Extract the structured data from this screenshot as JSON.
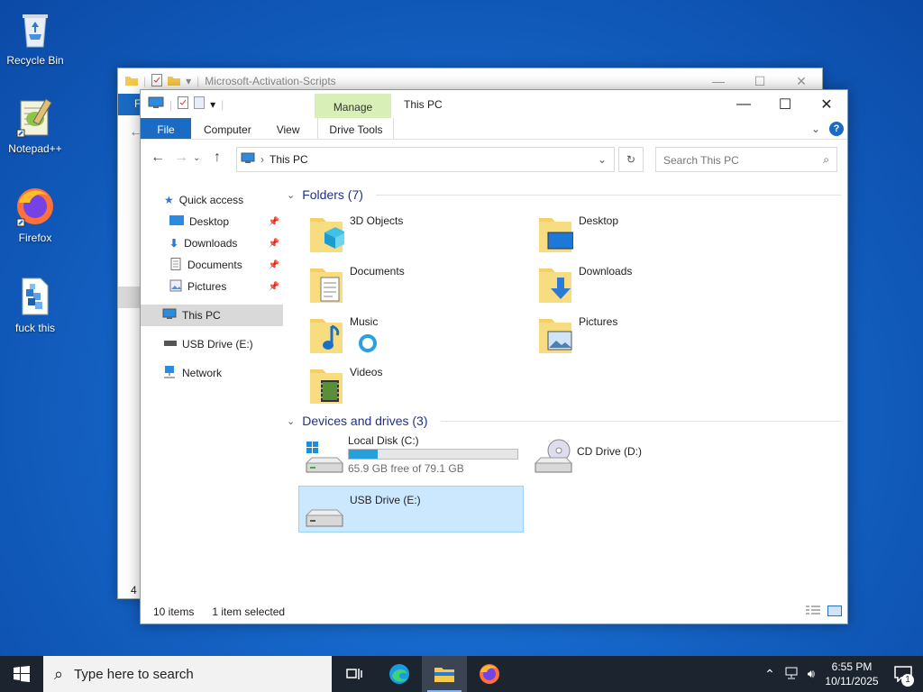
{
  "desktop": {
    "icons": [
      {
        "label": "Recycle Bin",
        "icon": "recycle-bin-icon"
      },
      {
        "label": "Notepad++",
        "icon": "notepad-plus-plus-icon"
      },
      {
        "label": "Firefox",
        "icon": "firefox-icon"
      },
      {
        "label": "fuck this",
        "icon": "batch-file-icon"
      }
    ]
  },
  "back_window": {
    "title": "Microsoft-Activation-Scripts",
    "ribbon_file_label": "F",
    "status_partial": "4 i"
  },
  "window": {
    "title": "This PC",
    "contextual_tab_group": "Manage",
    "tabs": [
      "File",
      "Computer",
      "View",
      "Drive Tools"
    ],
    "address": "This PC",
    "search_placeholder": "Search This PC",
    "nav": {
      "quick_access": "Quick access",
      "pinned": [
        "Desktop",
        "Downloads",
        "Documents",
        "Pictures"
      ],
      "this_pc": "This PC",
      "usb_drive": "USB Drive (E:)",
      "network": "Network"
    },
    "folders_header": "Folders (7)",
    "folders": [
      "3D Objects",
      "Desktop",
      "Documents",
      "Downloads",
      "Music",
      "Pictures",
      "Videos"
    ],
    "devices_header": "Devices and drives (3)",
    "drives": {
      "c": {
        "name": "Local Disk (C:)",
        "free": "65.9 GB free of 79.1 GB",
        "used_fraction": 0.17
      },
      "d": {
        "name": "CD Drive (D:)"
      },
      "e": {
        "name": "USB Drive (E:)"
      }
    },
    "status": {
      "items": "10 items",
      "selected": "1 item selected"
    }
  },
  "taskbar": {
    "search_placeholder": "Type here to search",
    "time": "6:55 PM",
    "date": "10/11/2025",
    "notification_count": "1"
  },
  "colors": {
    "accent": "#1a6bc4",
    "manage_tab": "#d8f0b8",
    "selection": "#cce8ff",
    "progress": "#26a0da"
  }
}
